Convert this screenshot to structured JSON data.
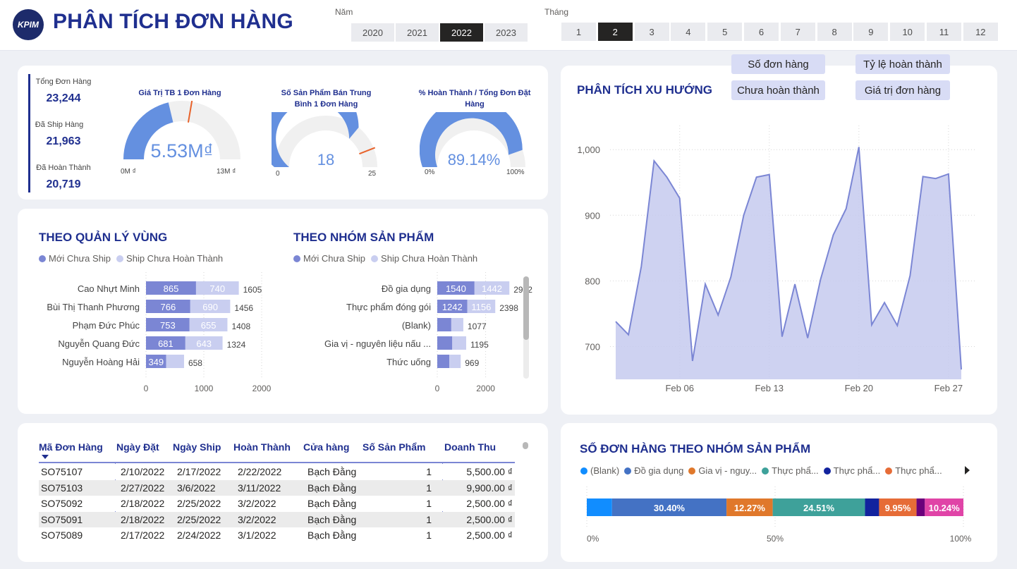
{
  "header": {
    "logo_text": "KPIM",
    "title": "PHÂN TÍCH ĐƠN HÀNG",
    "year_label": "Năm",
    "years": [
      "2020",
      "2021",
      "2022",
      "2023"
    ],
    "selected_year": "2022",
    "month_label": "Tháng",
    "months": [
      "1",
      "2",
      "3",
      "4",
      "5",
      "6",
      "7",
      "8",
      "9",
      "10",
      "11",
      "12"
    ],
    "selected_month": "2"
  },
  "kpis": {
    "items": [
      {
        "label": "Tổng Đơn Hàng",
        "value": "23,244"
      },
      {
        "label": "Đã Ship Hàng",
        "value": "21,963"
      },
      {
        "label": "Đã Hoàn Thành",
        "value": "20,719"
      }
    ],
    "accent": "#1f2f8f"
  },
  "gauges": [
    {
      "title": "Giá Trị TB 1 Đơn Hàng",
      "value_text": "5.53M₫",
      "min_label": "0M ₫",
      "max_label": "13M ₫",
      "value": 5.53,
      "max": 13,
      "target": 7.2
    },
    {
      "title": "Số Sản Phẩm Bán Trung Bình 1 Đơn Hàng",
      "value_text": "18",
      "min_label": "0",
      "max_label": "25",
      "value": 18,
      "max": 25,
      "target": 22
    },
    {
      "title": "% Hoàn Thành / Tổng Đơn Đặt Hàng",
      "value_text": "89.14%",
      "min_label": "0%",
      "max_label": "100%",
      "value": 89.14,
      "max": 100,
      "target": null
    }
  ],
  "colors": {
    "primary": "#7b86d4",
    "secondary": "#c9cef0",
    "gauge_fill": "#6490e0",
    "gauge_track": "#f0f0f0",
    "target": "#e8622a",
    "area_line": "#7b86d4",
    "area_fill": "#c5caef"
  },
  "trend": {
    "title": "PHÂN TÍCH XU HƯỚNG",
    "buttons": [
      "Số đơn hàng",
      "Tỷ lệ hoàn thành",
      "Chưa hoàn thành",
      "Giá trị đơn hàng"
    ]
  },
  "table": {
    "columns": [
      "Mã Đơn Hàng",
      "Ngày Đặt",
      "Ngày Ship",
      "Hoàn Thành",
      "Cửa hàng",
      "Số Sản Phẩm",
      "Doanh Thu"
    ],
    "rows": [
      [
        "SO75107",
        "2/10/2022",
        "2/17/2022",
        "2/22/2022",
        "Bạch Đằng",
        "1",
        "5,500.00 ₫"
      ],
      [
        "SO75103",
        "2/27/2022",
        "3/6/2022",
        "3/11/2022",
        "Bạch Đằng",
        "1",
        "9,900.00 ₫"
      ],
      [
        "SO75092",
        "2/18/2022",
        "2/25/2022",
        "3/2/2022",
        "Bạch Đằng",
        "1",
        "2,500.00 ₫"
      ],
      [
        "SO75091",
        "2/18/2022",
        "2/25/2022",
        "3/2/2022",
        "Bạch Đằng",
        "1",
        "2,500.00 ₫"
      ],
      [
        "SO75089",
        "2/17/2022",
        "2/24/2022",
        "3/1/2022",
        "Bạch Đằng",
        "1",
        "2,500.00 ₫"
      ]
    ]
  },
  "chart_data": [
    {
      "type": "bar",
      "orientation": "horizontal",
      "stacked": true,
      "title": "THEO QUẢN LÝ VÙNG",
      "categories": [
        "Cao Nhựt Minh",
        "Bùi Thị Thanh Phương",
        "Phạm Đức Phúc",
        "Nguyễn Quang Đức",
        "Nguyễn Hoàng Hải"
      ],
      "series": [
        {
          "name": "Mới Chưa Ship",
          "values": [
            865,
            766,
            753,
            681,
            349
          ]
        },
        {
          "name": "Ship Chưa Hoàn Thành",
          "values": [
            740,
            690,
            655,
            643,
            309
          ]
        }
      ],
      "totals": [
        1605,
        1456,
        1408,
        1324,
        658
      ],
      "xticks": [
        0,
        1000,
        2000
      ],
      "xlim": [
        0,
        2000
      ],
      "legend": "top"
    },
    {
      "type": "bar",
      "orientation": "horizontal",
      "stacked": true,
      "title": "THEO NHÓM SẢN PHẨM",
      "categories": [
        "Đồ gia dụng",
        "Thực phẩm đóng gói",
        "(Blank)",
        "Gia vị - nguyên liệu nấu ...",
        "Thức uống"
      ],
      "series": [
        {
          "name": "Mới Chưa Ship",
          "values": [
            1540,
            1242,
            580,
            620,
            500
          ]
        },
        {
          "name": "Ship Chưa Hoàn Thành",
          "values": [
            1442,
            1156,
            497,
            575,
            469
          ]
        }
      ],
      "totals": [
        2982,
        2398,
        1077,
        1195,
        969
      ],
      "xticks": [
        0,
        2000
      ],
      "xlim": [
        0,
        2800
      ],
      "legend": "top"
    },
    {
      "type": "area",
      "title": "PHÂN TÍCH XU HƯỚNG",
      "x": [
        "2022-02-01",
        "2022-02-02",
        "2022-02-03",
        "2022-02-04",
        "2022-02-05",
        "2022-02-06",
        "2022-02-07",
        "2022-02-08",
        "2022-02-09",
        "2022-02-10",
        "2022-02-11",
        "2022-02-12",
        "2022-02-13",
        "2022-02-14",
        "2022-02-15",
        "2022-02-16",
        "2022-02-17",
        "2022-02-18",
        "2022-02-19",
        "2022-02-20",
        "2022-02-21",
        "2022-02-22",
        "2022-02-23",
        "2022-02-24",
        "2022-02-25",
        "2022-02-26",
        "2022-02-27",
        "2022-02-28"
      ],
      "values": [
        738,
        718,
        822,
        983,
        958,
        926,
        678,
        795,
        748,
        806,
        900,
        958,
        962,
        715,
        795,
        713,
        802,
        870,
        910,
        1004,
        733,
        767,
        732,
        808,
        959,
        956,
        963,
        665
      ],
      "xticks": [
        "Feb 06",
        "Feb 13",
        "Feb 20",
        "Feb 27"
      ],
      "yticks": [
        700,
        800,
        900,
        1000
      ],
      "ytick_labels": [
        "700",
        "800",
        "900",
        "1,000"
      ],
      "ylim": [
        650,
        1040
      ]
    },
    {
      "type": "bar",
      "orientation": "horizontal",
      "stacked": true,
      "percent": true,
      "title": "SỐ ĐƠN HÀNG THEO NHÓM SẢN PHẨM",
      "series": [
        {
          "name": "(Blank)",
          "value": 6.7,
          "label": "",
          "color": "#118dff"
        },
        {
          "name": "Đồ gia dụng",
          "value": 30.4,
          "label": "30.40%",
          "color": "#4472c4"
        },
        {
          "name": "Gia vị - nguy...",
          "value": 12.27,
          "label": "12.27%",
          "color": "#e0782b"
        },
        {
          "name": "Thực phẩ...",
          "value": 24.51,
          "label": "24.51%",
          "color": "#3ea19a"
        },
        {
          "name": "Thực phẩ...",
          "value": 3.73,
          "label": "",
          "color": "#12239e"
        },
        {
          "name": "Thực phẩ...",
          "value": 9.95,
          "label": "9.95%",
          "color": "#e66c37"
        },
        {
          "name": "",
          "value": 2.2,
          "label": "",
          "color": "#6b007b"
        },
        {
          "name": "",
          "value": 10.24,
          "label": "10.24%",
          "color": "#e044a7"
        }
      ],
      "xticks": [
        "0%",
        "50%",
        "100%"
      ]
    }
  ]
}
